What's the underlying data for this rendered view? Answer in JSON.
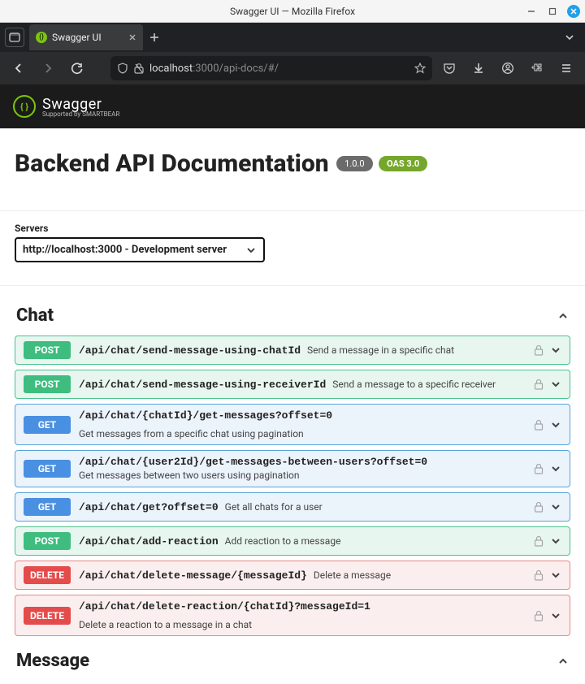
{
  "window": {
    "title": "Swagger UI — Mozilla Firefox"
  },
  "browser": {
    "tab_title": "Swagger UI",
    "url_host": "localhost",
    "url_port_path": ":3000/api-docs/#/"
  },
  "swagger": {
    "brand": "Swagger",
    "supported_by": "Supported by SMARTBEAR"
  },
  "header": {
    "title": "Backend API Documentation",
    "version": "1.0.0",
    "oas": "OAS 3.0"
  },
  "servers": {
    "label": "Servers",
    "selected": "http://localhost:3000 - Development server"
  },
  "tags": [
    {
      "name": "Chat",
      "ops": [
        {
          "method": "POST",
          "path": "/api/chat/send-message-using-chatId",
          "desc": "Send a message in a specific chat",
          "stack": false
        },
        {
          "method": "POST",
          "path": "/api/chat/send-message-using-receiverId",
          "desc": "Send a message to a specific receiver",
          "stack": false
        },
        {
          "method": "GET",
          "path": "/api/chat/{chatId}/get-messages?offset=0",
          "desc": "Get messages from a specific chat using pagination",
          "stack": false
        },
        {
          "method": "GET",
          "path": "/api/chat/{user2Id}/get-messages-between-users?offset=0",
          "desc": "Get messages between two users using pagination",
          "stack": true
        },
        {
          "method": "GET",
          "path": "/api/chat/get?offset=0",
          "desc": "Get all chats for a user",
          "stack": false
        },
        {
          "method": "POST",
          "path": "/api/chat/add-reaction",
          "desc": "Add reaction to a message",
          "stack": false
        },
        {
          "method": "DELETE",
          "path": "/api/chat/delete-message/{messageId}",
          "desc": "Delete a message",
          "stack": false
        },
        {
          "method": "DELETE",
          "path": "/api/chat/delete-reaction/{chatId}?messageId=1",
          "desc": "Delete a reaction to a message in a chat",
          "stack": false
        }
      ]
    },
    {
      "name": "Message",
      "ops": []
    }
  ]
}
